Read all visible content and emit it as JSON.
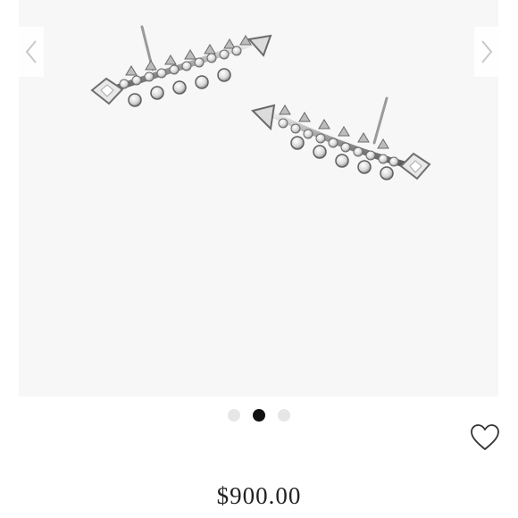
{
  "gallery": {
    "slide_count": 3,
    "active_slide": 2,
    "image_alt_name": "diamond-ear-climber-earrings-image"
  },
  "icons": {
    "prev": "chevron-left-icon",
    "next": "chevron-right-icon",
    "wishlist": "heart-outline-icon"
  },
  "colors": {
    "arrow": "#c8c8c8",
    "dot_active": "#111111",
    "dot_inactive": "#e6e6e6",
    "price_text": "#222222",
    "image_bg": "#f7f7f7"
  },
  "product": {
    "price": "$900.00"
  }
}
